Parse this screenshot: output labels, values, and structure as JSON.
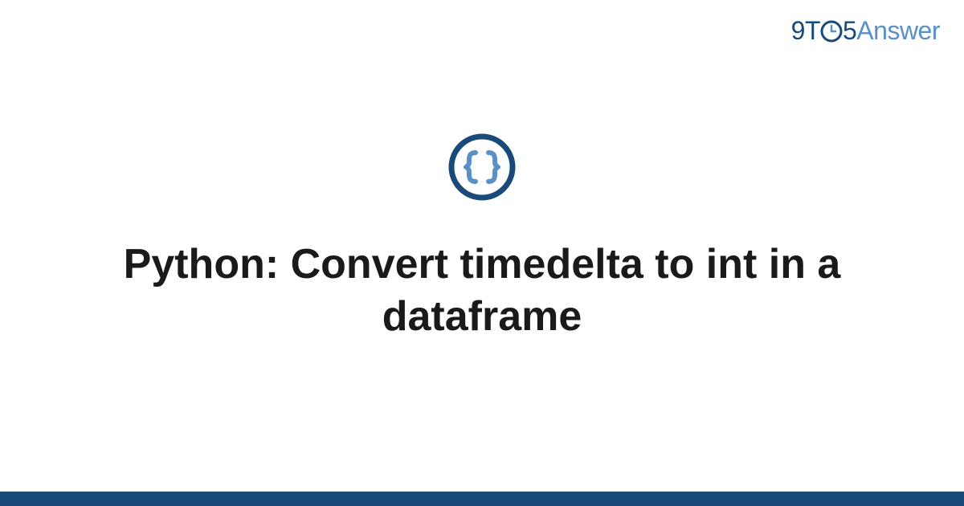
{
  "brand": {
    "nine": "9",
    "t": "T",
    "five": "5",
    "answer": "Answer"
  },
  "title": "Python: Convert timedelta to int in a dataframe",
  "colors": {
    "dark_blue": "#1a4a7a",
    "light_blue": "#5a8fc7"
  }
}
